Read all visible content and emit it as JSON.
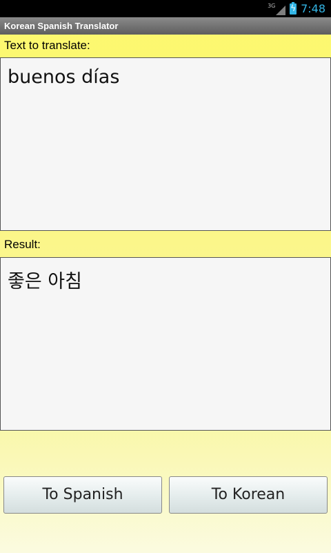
{
  "status_bar": {
    "network": "3G",
    "time": "7:48"
  },
  "app": {
    "title": "Korean Spanish Translator"
  },
  "input_section": {
    "label": "Text to translate:",
    "value": "buenos días"
  },
  "result_section": {
    "label": "Result:",
    "value": "좋은 아침"
  },
  "buttons": {
    "to_spanish": "To Spanish",
    "to_korean": "To Korean"
  },
  "colors": {
    "background": "#fdf96a",
    "title_bar": "#6f6f6f",
    "status_accent": "#33b5e5"
  }
}
